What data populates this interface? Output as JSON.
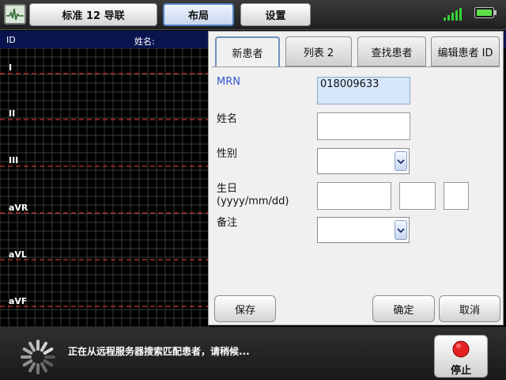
{
  "toolbar": {
    "app_icon": "ecg-waveform-icon",
    "leads_label": "标准 12 导联",
    "layout_label": "布局",
    "settings_label": "设置",
    "signal_icon": "signal-strength-icon",
    "battery_icon": "battery-icon",
    "accent_color": "#4f7fc0"
  },
  "ecg": {
    "header": {
      "id_label": "ID",
      "name_label": "姓名:"
    },
    "leads": [
      "I",
      "II",
      "III",
      "aVR",
      "aVL",
      "aVF"
    ],
    "grid_color": "#3a3a3a",
    "trace_color": "#d03030"
  },
  "dialog": {
    "tabs": [
      {
        "label": "新患者",
        "active": true
      },
      {
        "label": "列表 2",
        "active": false
      },
      {
        "label": "查找患者",
        "active": false
      },
      {
        "label": "编辑患者 ID",
        "active": false
      }
    ],
    "fields": {
      "mrn_label": "MRN",
      "mrn_value": "018009633",
      "name_label": "姓名",
      "name_value": "",
      "sex_label": "性别",
      "sex_value": "",
      "dob_label": "生日",
      "dob_format": "(yyyy/mm/dd)",
      "notes_label": "备注",
      "notes_value": ""
    },
    "buttons": {
      "save": "保存",
      "ok": "确定",
      "cancel": "取消"
    }
  },
  "status": {
    "message": "正在从远程服务器搜索匹配患者，请稍候...",
    "stop_label": "停止",
    "stop_icon": "stop-icon",
    "spinner_icon": "loading-spinner-icon"
  }
}
